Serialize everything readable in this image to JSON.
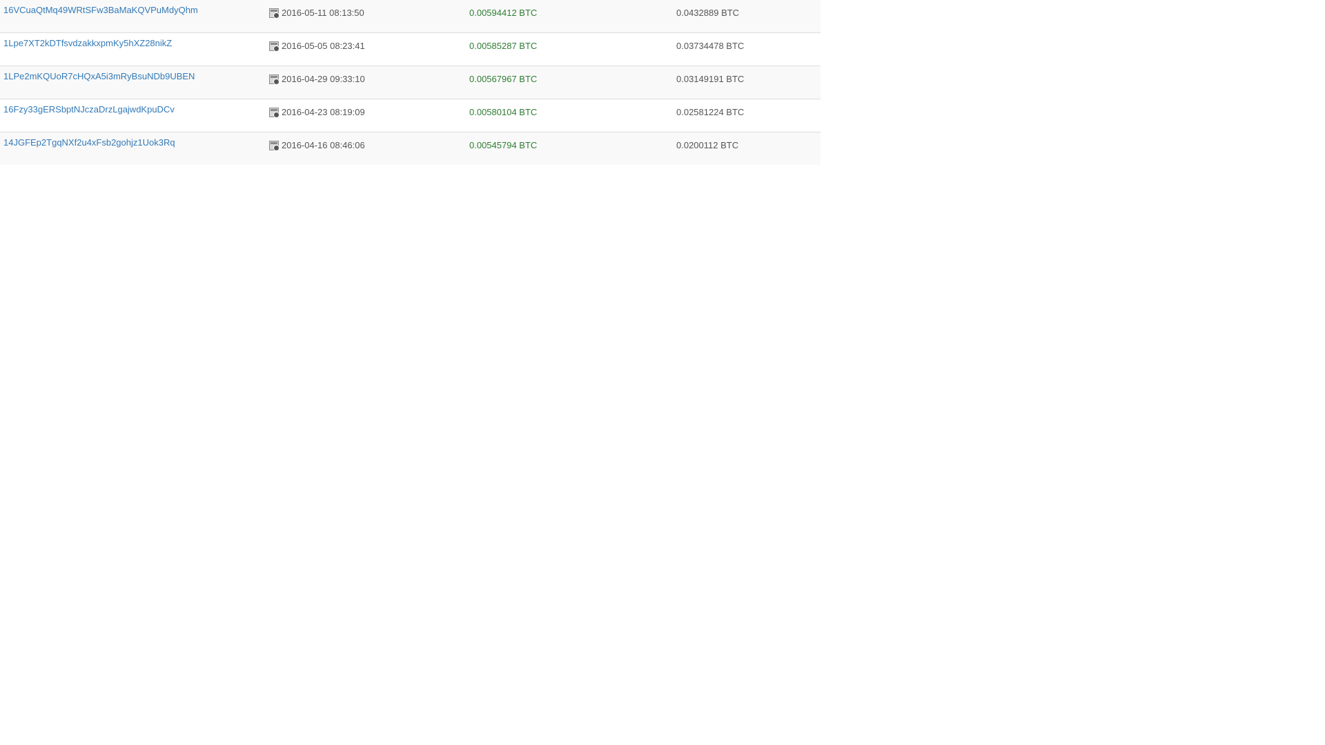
{
  "rows": [
    {
      "address": "16VCuaQtMq49WRtSFw3BaMaKQVPuMdyQhm",
      "time": "2016-05-11 08:13:50",
      "amount": "0.00594412 BTC",
      "balance": "0.0432889 BTC"
    },
    {
      "address": "1Lpe7XT2kDTfsvdzakkxpmKy5hXZ28nikZ",
      "time": "2016-05-05 08:23:41",
      "amount": "0.00585287 BTC",
      "balance": "0.03734478 BTC"
    },
    {
      "address": "1LPe2mKQUoR7cHQxA5i3mRyBsuNDb9UBEN",
      "time": "2016-04-29 09:33:10",
      "amount": "0.00567967 BTC",
      "balance": "0.03149191 BTC"
    },
    {
      "address": "16Fzy33gERSbptNJczaDrzLgajwdKpuDCv",
      "time": "2016-04-23 08:19:09",
      "amount": "0.00580104 BTC",
      "balance": "0.02581224 BTC"
    },
    {
      "address": "14JGFEp2TgqNXf2u4xFsb2gohjz1Uok3Rq",
      "time": "2016-04-16 08:46:06",
      "amount": "0.00545794 BTC",
      "balance": "0.0200112 BTC"
    }
  ],
  "icons": {
    "time": "calendar-clock-icon"
  },
  "colors": {
    "link": "#337ab7",
    "amount": "#2e7d32",
    "text": "#555555",
    "stripe": "#f9f9f9",
    "border": "#dddddd"
  }
}
